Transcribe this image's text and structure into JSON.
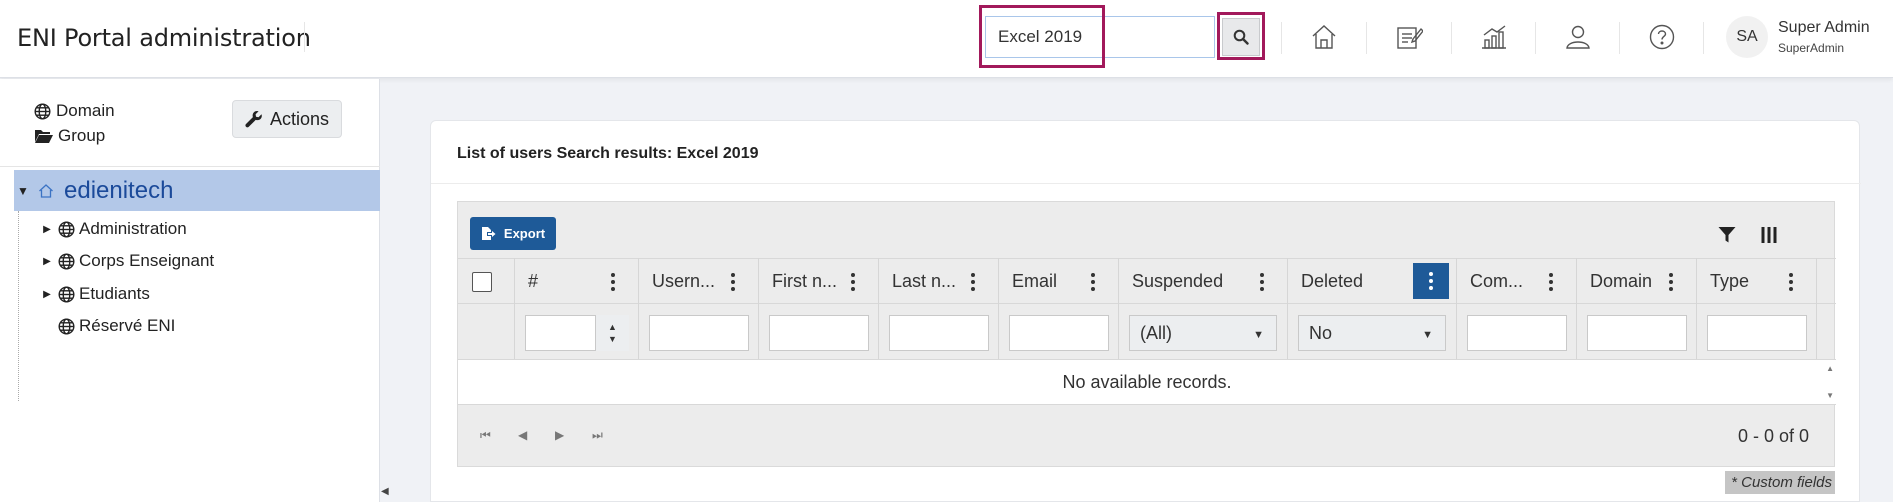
{
  "header": {
    "title": "ENI Portal administration",
    "search_value": "Excel 2019",
    "nav_icons": [
      "home-icon",
      "edit-document-icon",
      "statistics-icon",
      "user-icon",
      "help-icon"
    ],
    "user": {
      "initials": "SA",
      "name": "Super Admin",
      "role": "SuperAdmin"
    }
  },
  "sidebar": {
    "domain_label": "Domain",
    "group_label": "Group",
    "actions_label": "Actions",
    "tree": {
      "root": "edienitech",
      "children": [
        "Administration",
        "Corps Enseignant",
        "Etudiants",
        "Réservé ENI"
      ]
    }
  },
  "panel": {
    "title": "List of users Search results: Excel 2019",
    "export_label": "Export",
    "columns": [
      "#",
      "Usern...",
      "First n...",
      "Last n...",
      "Email",
      "Suspended",
      "Deleted",
      "Com...",
      "Domain",
      "Type"
    ],
    "filters": {
      "suspended": "(All)",
      "deleted": "No"
    },
    "empty_message": "No available records.",
    "pager_info": "0 - 0 of 0",
    "custom_fields_note": "* Custom fields"
  },
  "colors": {
    "accent": "#1e5a98",
    "highlight": "#a2195b",
    "tree_selected": "#b3c8e8"
  }
}
